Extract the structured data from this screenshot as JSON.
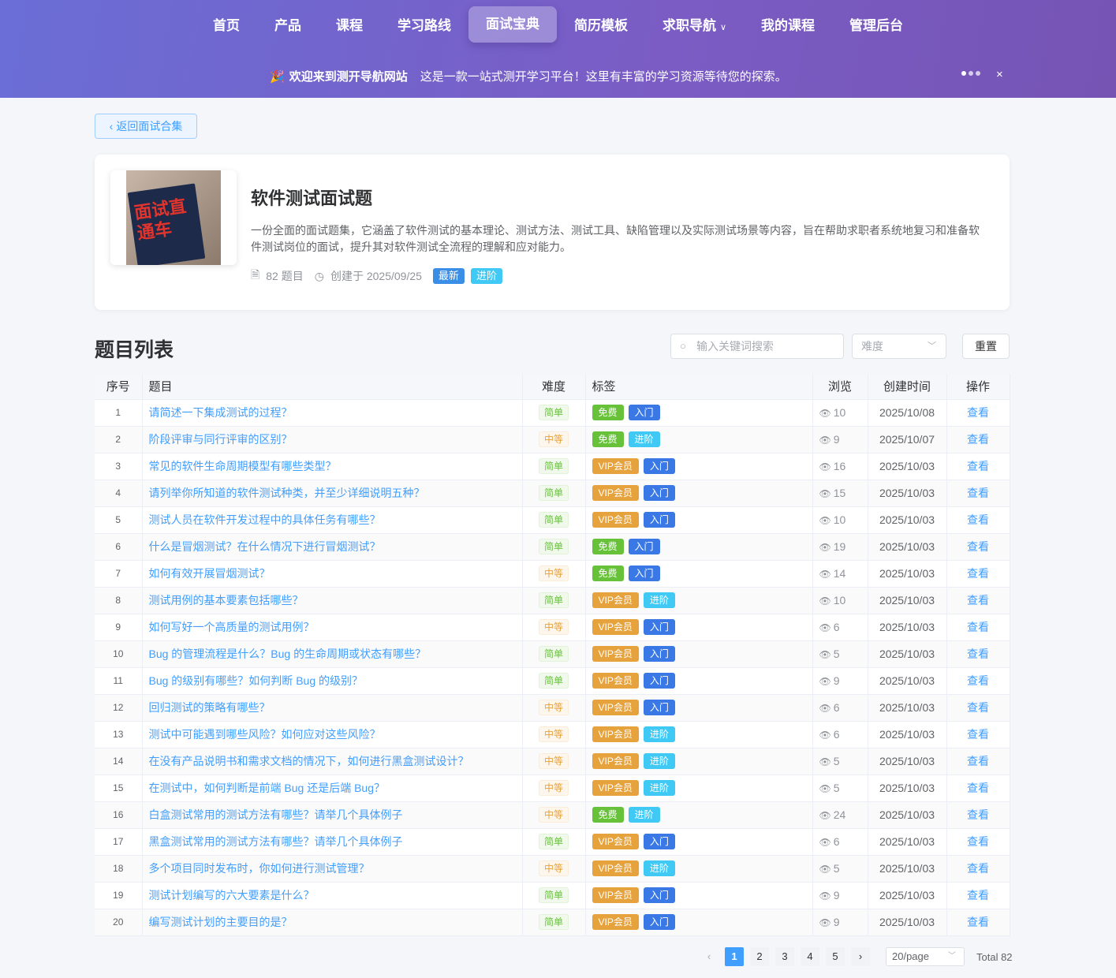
{
  "nav": {
    "items": [
      "首页",
      "产品",
      "课程",
      "学习路线",
      "面试宝典",
      "简历模板",
      "求职导航",
      "我的课程",
      "管理后台"
    ],
    "active": 4,
    "dropdown": 6
  },
  "banner": {
    "title": "欢迎来到测开导航网站",
    "text": "这是一款一站式测开学习平台！这里有丰富的学习资源等待您的探索。",
    "close": "×"
  },
  "back_label": "返回面试合集",
  "collection": {
    "cover_text": "面试直通车",
    "title": "软件测试面试题",
    "description": "一份全面的面试题集，它涵盖了软件测试的基本理论、测试方法、测试工具、缺陷管理以及实际测试场景等内容，旨在帮助求职者系统地复习和准备软件测试岗位的面试，提升其对软件测试全流程的理解和应对能力。",
    "count": "82 题目",
    "created": "创建于 2025/09/25",
    "tags": [
      {
        "label": "最新",
        "color": "#3a8ee6"
      },
      {
        "label": "进阶",
        "color": "#40c9f5"
      }
    ]
  },
  "list": {
    "title": "题目列表",
    "search_placeholder": "输入关键词搜索",
    "difficulty_placeholder": "难度",
    "reset": "重置",
    "columns": [
      "序号",
      "题目",
      "难度",
      "标签",
      "浏览",
      "创建时间",
      "操作"
    ],
    "action": "查看",
    "rows": [
      [
        1,
        "请简述一下集成测试的过程？",
        "简单",
        [
          "免费",
          "入门"
        ],
        10,
        "2025/10/08"
      ],
      [
        2,
        "阶段评审与同行评审的区别？",
        "中等",
        [
          "免费",
          "进阶"
        ],
        9,
        "2025/10/07"
      ],
      [
        3,
        "常见的软件生命周期模型有哪些类型？",
        "简单",
        [
          "VIP会员",
          "入门"
        ],
        16,
        "2025/10/03"
      ],
      [
        4,
        "请列举你所知道的软件测试种类，并至少详细说明五种？",
        "简单",
        [
          "VIP会员",
          "入门"
        ],
        15,
        "2025/10/03"
      ],
      [
        5,
        "测试人员在软件开发过程中的具体任务有哪些？",
        "简单",
        [
          "VIP会员",
          "入门"
        ],
        10,
        "2025/10/03"
      ],
      [
        6,
        "什么是冒烟测试？在什么情况下进行冒烟测试？",
        "简单",
        [
          "免费",
          "入门"
        ],
        19,
        "2025/10/03"
      ],
      [
        7,
        "如何有效开展冒烟测试？",
        "中等",
        [
          "免费",
          "入门"
        ],
        14,
        "2025/10/03"
      ],
      [
        8,
        "测试用例的基本要素包括哪些？",
        "简单",
        [
          "VIP会员",
          "进阶"
        ],
        10,
        "2025/10/03"
      ],
      [
        9,
        "如何写好一个高质量的测试用例？",
        "中等",
        [
          "VIP会员",
          "入门"
        ],
        6,
        "2025/10/03"
      ],
      [
        10,
        "Bug 的管理流程是什么？Bug 的生命周期或状态有哪些？",
        "简单",
        [
          "VIP会员",
          "入门"
        ],
        5,
        "2025/10/03"
      ],
      [
        11,
        "Bug 的级别有哪些？如何判断 Bug 的级别？",
        "简单",
        [
          "VIP会员",
          "入门"
        ],
        9,
        "2025/10/03"
      ],
      [
        12,
        "回归测试的策略有哪些？",
        "中等",
        [
          "VIP会员",
          "入门"
        ],
        6,
        "2025/10/03"
      ],
      [
        13,
        "测试中可能遇到哪些风险？如何应对这些风险？",
        "中等",
        [
          "VIP会员",
          "进阶"
        ],
        6,
        "2025/10/03"
      ],
      [
        14,
        "在没有产品说明书和需求文档的情况下，如何进行黑盒测试设计？",
        "中等",
        [
          "VIP会员",
          "进阶"
        ],
        5,
        "2025/10/03"
      ],
      [
        15,
        "在测试中，如何判断是前端 Bug 还是后端 Bug？",
        "中等",
        [
          "VIP会员",
          "进阶"
        ],
        5,
        "2025/10/03"
      ],
      [
        16,
        "白盒测试常用的测试方法有哪些？请举几个具体例子",
        "中等",
        [
          "免费",
          "进阶"
        ],
        24,
        "2025/10/03"
      ],
      [
        17,
        "黑盒测试常用的测试方法有哪些？请举几个具体例子",
        "简单",
        [
          "VIP会员",
          "入门"
        ],
        6,
        "2025/10/03"
      ],
      [
        18,
        "多个项目同时发布时，你如何进行测试管理？",
        "中等",
        [
          "VIP会员",
          "进阶"
        ],
        5,
        "2025/10/03"
      ],
      [
        19,
        "测试计划编写的六大要素是什么？",
        "简单",
        [
          "VIP会员",
          "入门"
        ],
        9,
        "2025/10/03"
      ],
      [
        20,
        "编写测试计划的主要目的是？",
        "简单",
        [
          "VIP会员",
          "入门"
        ],
        9,
        "2025/10/03"
      ]
    ]
  },
  "tag_colors": {
    "免费": "#67c23a",
    "入门": "#3a78e6",
    "进阶": "#40c9f5",
    "VIP会员": "#e6a23c"
  },
  "pagination": {
    "pages": [
      "1",
      "2",
      "3",
      "4",
      "5"
    ],
    "current": 1,
    "page_size": "20/page",
    "total": "Total 82"
  }
}
